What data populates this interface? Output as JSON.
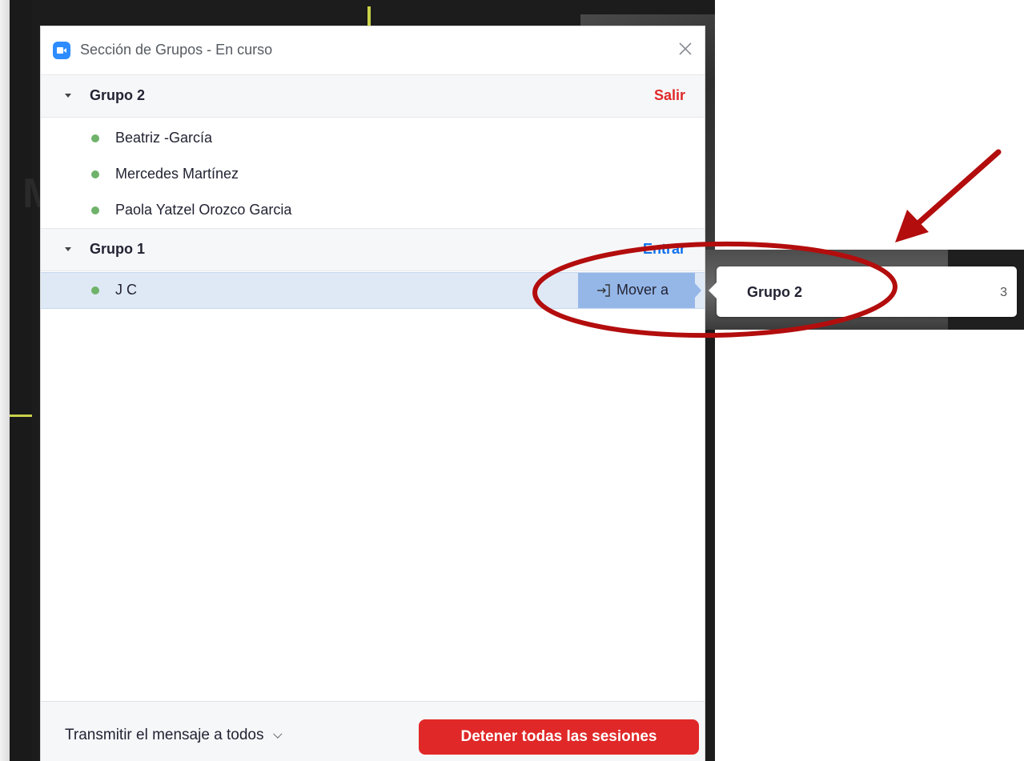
{
  "window": {
    "title": "Sección de Grupos - En curso"
  },
  "groups": [
    {
      "name": "Grupo 2",
      "action": "Salir",
      "action_color": "#e02828",
      "members": [
        "Beatriz -García",
        "Mercedes Martínez",
        "Paola Yatzel Orozco Garcia"
      ]
    },
    {
      "name": "Grupo 1",
      "action": "Entrar",
      "action_color": "#0e72ed",
      "members": [
        "J C"
      ]
    }
  ],
  "member_row": {
    "move_label": "Mover a"
  },
  "submenu": {
    "items": [
      {
        "name": "Grupo 2",
        "count": "3"
      }
    ]
  },
  "footer": {
    "broadcast_label": "Transmitir el mensaje a todos",
    "stop_label": "Detener todas las sesiones"
  },
  "background": {
    "letter": "M"
  },
  "colors": {
    "accent_blue": "#2d8cff",
    "danger_red": "#e02828",
    "online_green": "#6fb36a",
    "annotation_red": "#b30d0d"
  }
}
